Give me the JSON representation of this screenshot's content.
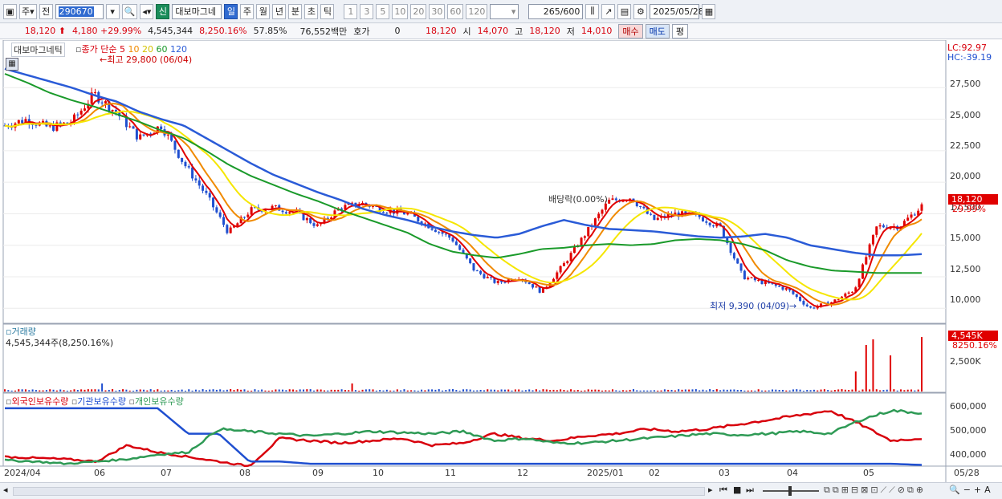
{
  "toolbar": {
    "type1": "주",
    "type2": "전",
    "code": "290670",
    "new_badge": "신",
    "stock_name": "대보마그네",
    "periods": [
      "일",
      "주",
      "월",
      "년",
      "분",
      "초",
      "틱"
    ],
    "selected_period": "일",
    "intervals": [
      "1",
      "3",
      "5",
      "10",
      "20",
      "30",
      "60",
      "120"
    ],
    "count": "265",
    "count_total": "/600",
    "date": "2025/05/28"
  },
  "quote": {
    "price": "18,120",
    "change": "4,180",
    "change_pct": "+29.99%",
    "volume": "4,545,344",
    "volume_pct": "8,250.16%",
    "ratio": "57.85%",
    "amount": "76,552백만",
    "hoga_label": "호가",
    "hoga_value": "0",
    "hoga_price": "18,120",
    "open_label": "시",
    "open": "14,070",
    "high_label": "고",
    "high": "18,120",
    "low_label": "저",
    "low": "14,010",
    "buy": "매수",
    "sell": "매도",
    "eval": "평"
  },
  "main_chart": {
    "name": "대보마그네틱",
    "legend_prefix": "종가 단순",
    "ma_periods": [
      "5",
      "10",
      "20",
      "60",
      "120"
    ],
    "ma_colors": [
      "#e00000",
      "#f08a00",
      "#f5e600",
      "#1a9a2a",
      "#2a5bd7"
    ],
    "lc": "LC:92.97",
    "hc": "HC:-39.19",
    "max_note": "최고 29,800 (06/04)",
    "min_note": "최저 9,390 (04/09)",
    "dividend_note": "배당락(0.00%)",
    "last_price_tag": "18,120",
    "last_pct_tag": "29.99%",
    "y_ticks": [
      "27,500",
      "25,000",
      "22,500",
      "20,000",
      "17,500",
      "15,000",
      "12,500",
      "10,000"
    ]
  },
  "volume_chart": {
    "title": "거래량",
    "value_text": "4,545,344주(8,250.16%)",
    "tag": "4,545K",
    "tag_pct": "8250.16%",
    "y_tick": "2,500K"
  },
  "holdings_chart": {
    "legend": [
      "외국인보유수량",
      "기관보유수량",
      "개인보유수량"
    ],
    "colors": [
      "#d8000c",
      "#1f4fd0",
      "#2e9a55"
    ],
    "y_ticks": [
      "600,000",
      "500,000",
      "400,000"
    ]
  },
  "x_axis": [
    "2024/04",
    "06",
    "07",
    "08",
    "09",
    "10",
    "11",
    "12",
    "2025/01",
    "02",
    "03",
    "04",
    "05",
    "05/28"
  ],
  "chart_data": {
    "type": "line",
    "series": [
      {
        "name": "종가",
        "values": [
          24500,
          25000,
          24300,
          24800,
          27000,
          25500,
          23500,
          24500,
          21500,
          19000,
          16000,
          17800,
          18000,
          17600,
          16500,
          18000,
          18300,
          17800,
          17500,
          16500,
          15500,
          13000,
          12000,
          12500,
          11300,
          13500,
          16000,
          18500,
          18800,
          17000,
          17500,
          17300,
          16400,
          12500,
          12000,
          11500,
          10000,
          10500,
          11500,
          16500,
          16500,
          18120
        ]
      },
      {
        "name": "120",
        "values": [
          29000,
          28500,
          28000,
          27500,
          26900,
          26400,
          25600,
          25000,
          24500,
          23500,
          22500,
          21500,
          20600,
          19900,
          19200,
          18600,
          17900,
          17400,
          17000,
          16500,
          16100,
          15800,
          15600,
          15900,
          16500,
          17000,
          16600,
          16300,
          16200,
          16100,
          15900,
          15700,
          15600,
          15700,
          15900,
          15600,
          15000,
          14700,
          14400,
          14200,
          14200,
          14300
        ]
      },
      {
        "name": "60",
        "values": [
          28600,
          27900,
          27100,
          26500,
          26000,
          25400,
          24800,
          24100,
          23500,
          22500,
          21400,
          20500,
          19800,
          19100,
          18500,
          17800,
          17200,
          16600,
          16000,
          15100,
          14500,
          14200,
          14000,
          14300,
          14700,
          14800,
          15000,
          15100,
          15000,
          15100,
          15400,
          15500,
          15400,
          15100,
          14600,
          13800,
          13300,
          13000,
          12900,
          12800,
          12800,
          12800
        ]
      }
    ],
    "ylim": [
      9000,
      30000
    ]
  }
}
